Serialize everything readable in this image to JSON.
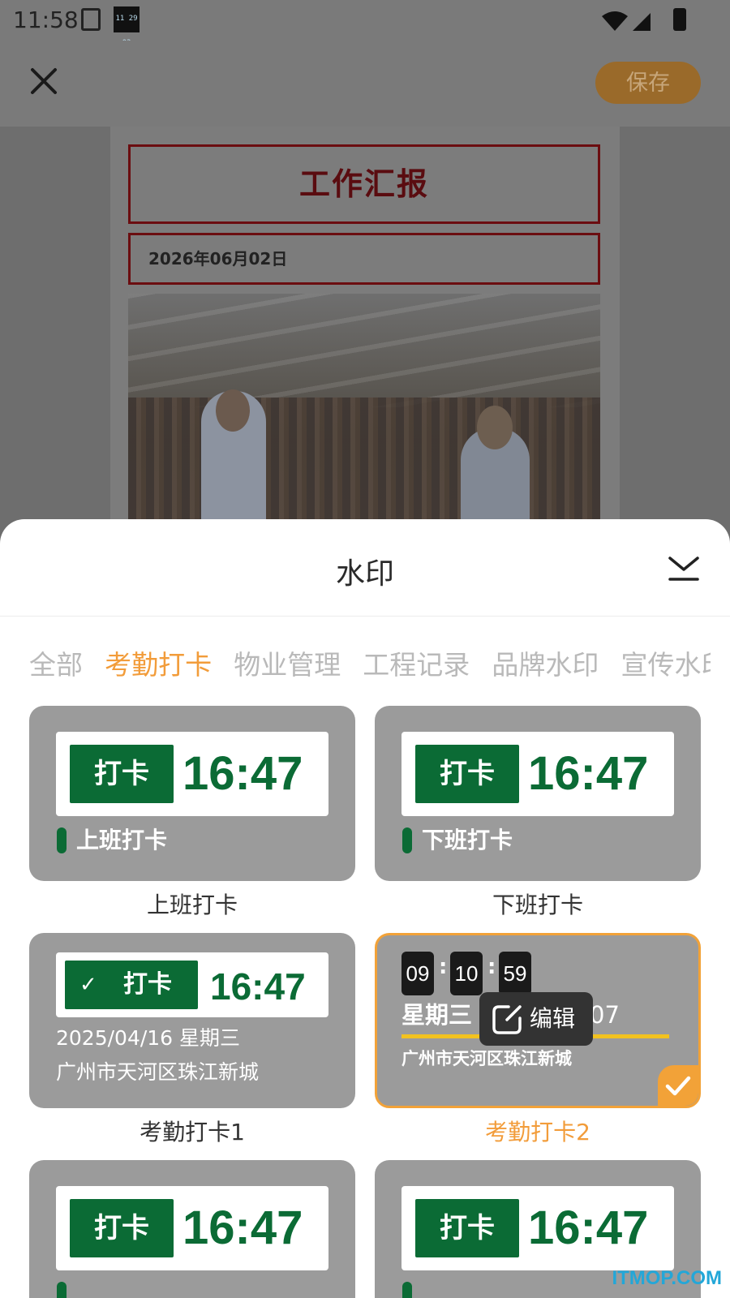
{
  "status_bar": {
    "time": "11:58",
    "mini_widget": "11 29 03"
  },
  "app_bar": {
    "save_label": "保存"
  },
  "document": {
    "title": "工作汇报",
    "date": "2026年06月02日"
  },
  "sheet": {
    "title": "水印",
    "tabs": [
      {
        "label": "全部",
        "active": false
      },
      {
        "label": "考勤打卡",
        "active": true
      },
      {
        "label": "物业管理",
        "active": false
      },
      {
        "label": "工程记录",
        "active": false
      },
      {
        "label": "品牌水印",
        "active": false
      },
      {
        "label": "宣传水印",
        "active": false
      }
    ],
    "cards": [
      {
        "name": "上班打卡",
        "badge": "打卡",
        "time": "16:47",
        "sub": "上班打卡"
      },
      {
        "name": "下班打卡",
        "badge": "打卡",
        "time": "16:47",
        "sub": "下班打卡"
      },
      {
        "name": "考勤打卡1",
        "badge": "打卡",
        "time": "16:47",
        "date_line": "2025/04/16 星期三",
        "address": "广州市天河区珠江新城"
      },
      {
        "name": "考勤打卡2",
        "selected": true,
        "hh": "09",
        "mm": "10",
        "ss": "59",
        "weekday": "星期三",
        "date_tail": "07",
        "address": "广州市天河区珠江新城",
        "edit_label": "编辑"
      },
      {
        "name": "",
        "badge": "打卡",
        "time": "16:47"
      },
      {
        "name": "",
        "badge": "打卡",
        "time": "16:47"
      }
    ]
  },
  "watermark": "ITMOP.COM",
  "colors": {
    "accent": "#f29c3a",
    "brand_green": "#0b6b35",
    "selected_border": "#f2a238"
  }
}
